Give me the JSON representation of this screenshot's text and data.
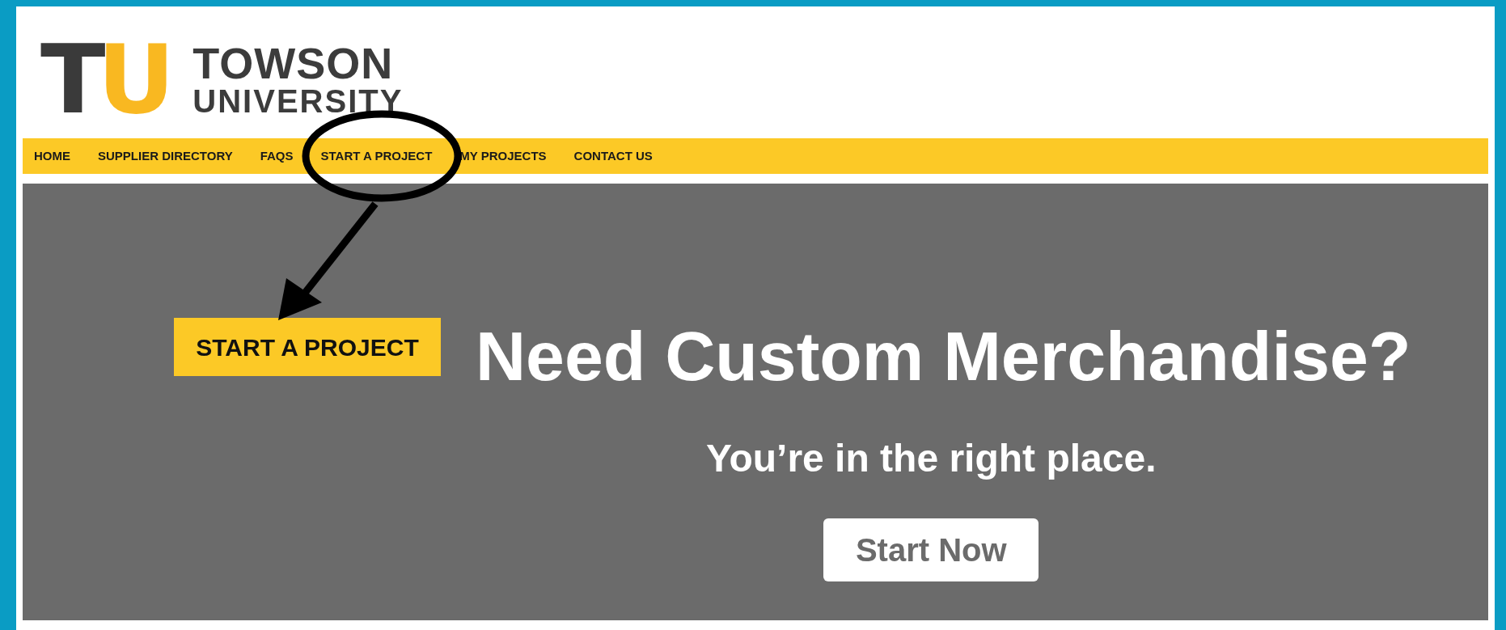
{
  "logo": {
    "mark": [
      "T",
      "U"
    ],
    "name_line_1": "TOWSON",
    "name_line_2": "UNIVERSITY"
  },
  "nav": [
    {
      "label": "HOME"
    },
    {
      "label": "SUPPLIER DIRECTORY"
    },
    {
      "label": "FAQS"
    },
    {
      "label": "START A PROJECT"
    },
    {
      "label": "MY PROJECTS"
    },
    {
      "label": "CONTACT US"
    }
  ],
  "annotation": {
    "callout": "START A PROJECT"
  },
  "hero": {
    "heading": "Need Custom Merchandise?",
    "subheading": "You’re in the right place.",
    "button": "Start Now"
  }
}
